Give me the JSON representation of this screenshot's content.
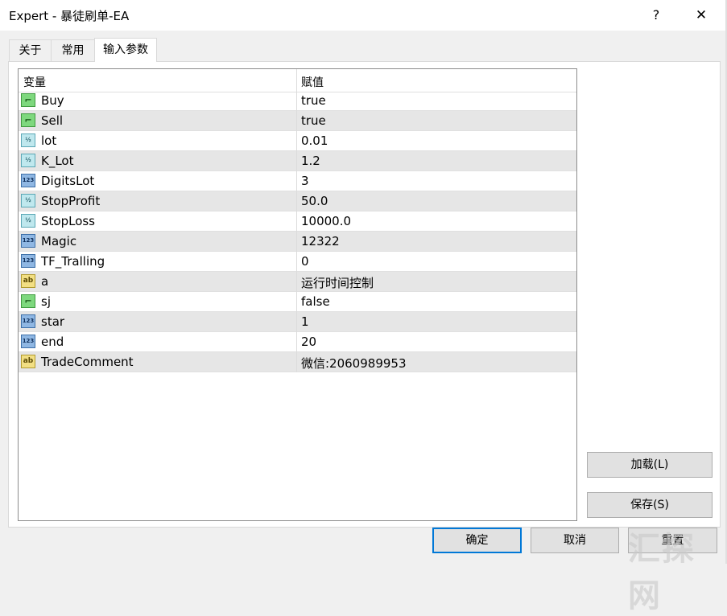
{
  "window": {
    "title": "Expert - 暴徒刷单-EA",
    "help_label": "?",
    "close_label": "✕"
  },
  "tabs": [
    {
      "label": "关于"
    },
    {
      "label": "常用"
    },
    {
      "label": "输入参数"
    }
  ],
  "grid": {
    "col_variable": "变量",
    "col_value": "赋值",
    "rows": [
      {
        "icon": "bool-icon",
        "name": "Buy",
        "value": "true"
      },
      {
        "icon": "double-icon",
        "name": "Sell",
        "value": "true"
      },
      {
        "icon": "double-icon",
        "name": "lot",
        "value": "0.01"
      },
      {
        "icon": "double-icon",
        "name": "K_Lot",
        "value": "1.2"
      },
      {
        "icon": "int-icon",
        "name": "DigitsLot",
        "value": "3"
      },
      {
        "icon": "double-icon",
        "name": "StopProfit",
        "value": "50.0"
      },
      {
        "icon": "double-icon",
        "name": "StopLoss",
        "value": "10000.0"
      },
      {
        "icon": "int-icon",
        "name": "Magic",
        "value": "12322"
      },
      {
        "icon": "int-icon",
        "name": "TF_Tralling",
        "value": "0"
      },
      {
        "icon": "string-icon",
        "name": "a",
        "value": "运行时间控制"
      },
      {
        "icon": "bool-icon",
        "name": "sj",
        "value": "false"
      },
      {
        "icon": "int-icon",
        "name": "star",
        "value": "1"
      },
      {
        "icon": "int-icon",
        "name": "end",
        "value": "20"
      },
      {
        "icon": "string-icon",
        "name": "TradeComment",
        "value": "微信:2060989953"
      }
    ]
  },
  "buttons": {
    "load": "加载(L)",
    "save": "保存(S)",
    "ok": "确定",
    "cancel": "取消",
    "reset": "重置"
  },
  "watermark": "汇探网"
}
